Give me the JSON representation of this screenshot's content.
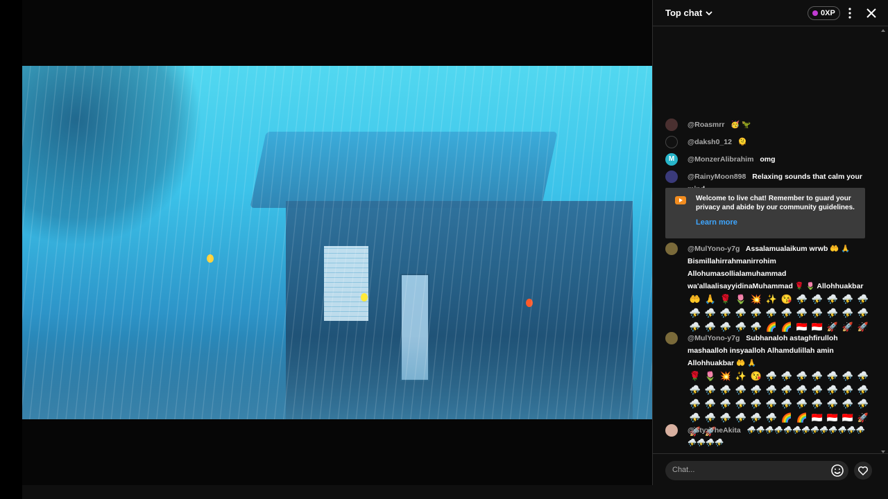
{
  "chat": {
    "title": "Top chat",
    "xp": "0XP",
    "messages": [
      {
        "author": "@Roasmrr",
        "text": "",
        "emojis": [
          "🥳",
          "🦖"
        ]
      },
      {
        "author": "@daksh0_12",
        "text": "",
        "emojis": [
          "🫠"
        ]
      },
      {
        "author": "@MonzerAlibrahim",
        "text": "omg",
        "emojis": []
      },
      {
        "author": "@RainyMoon898",
        "text": "Relaxing sounds that calm your mind.",
        "emojis": []
      },
      {
        "author": "@MulYono-y7g",
        "text": "Assalamualaikum wrwb 🤲 🙏 Bismillahirrahmanirrohim Allohumasollialamuhammad wa'allaalisayyidinaMuhammad 🌹 🌷 Allohhuakbar",
        "emojis": [
          "🤲",
          "🙏",
          "🌹",
          "🌷",
          "💥",
          "✨",
          "😘",
          "⛈️",
          "⛈️",
          "⛈️",
          "⛈️",
          "⛈️",
          "⛈️",
          "⛈️",
          "⛈️",
          "⛈️",
          "⛈️",
          "⛈️",
          "⛈️",
          "⛈️",
          "⛈️",
          "⛈️",
          "⛈️",
          "⛈️",
          "⛈️",
          "⛈️",
          "⛈️",
          "⛈️",
          "⛈️",
          "🌈",
          "🌈",
          "🇮🇩",
          "🇮🇩",
          "🚀",
          "🚀",
          "🚀"
        ]
      },
      {
        "author": "@MulYono-y7g",
        "text": "Subhanaloh astaghfirulloh mashaalloh insyaalloh Alhamdulillah amin Allohhuakbar 🤲 🙏",
        "emojis": [
          "🌹",
          "🌷",
          "💥",
          "✨",
          "😘",
          "⛈️",
          "⛈️",
          "⛈️",
          "⛈️",
          "⛈️",
          "⛈️",
          "⛈️",
          "⛈️",
          "⛈️",
          "⛈️",
          "⛈️",
          "⛈️",
          "⛈️",
          "⛈️",
          "⛈️",
          "⛈️",
          "⛈️",
          "⛈️",
          "⛈️",
          "⛈️",
          "⛈️",
          "⛈️",
          "⛈️",
          "⛈️",
          "⛈️",
          "⛈️",
          "⛈️",
          "⛈️",
          "⛈️",
          "⛈️",
          "⛈️",
          "⛈️",
          "⛈️",
          "⛈️",
          "⛈️",
          "⛈️",
          "⛈️",
          "🌈",
          "🌈",
          "🇮🇩",
          "🇮🇩",
          "🇮🇩",
          "🚀",
          "🚀",
          "🚀"
        ]
      },
      {
        "author": "@StyxTheAkita",
        "text": "",
        "emojis": [
          "⛈️",
          "⛈️",
          "⛈️",
          "⛈️",
          "⛈️",
          "⛈️",
          "⛈️",
          "⛈️",
          "⛈️",
          "⛈️",
          "⛈️",
          "⛈️",
          "⛈️",
          "⛈️",
          "⛈️",
          "⛈️",
          "⛈️"
        ]
      }
    ],
    "welcome": {
      "text": "Welcome to live chat! Remember to guard your privacy and abide by our community guidelines.",
      "link": "Learn more"
    },
    "input_placeholder": "Chat..."
  },
  "icons": {
    "dropdown": "chevron-down-icon",
    "more": "more-vert-icon",
    "close": "close-icon",
    "emoji": "smiley-icon",
    "heart": "heart-icon"
  },
  "colors": {
    "background": "#0f0f0f",
    "link": "#3ea6ff",
    "xp_dot": "#c23bd4",
    "welcome_box": "#3b3b3b"
  }
}
